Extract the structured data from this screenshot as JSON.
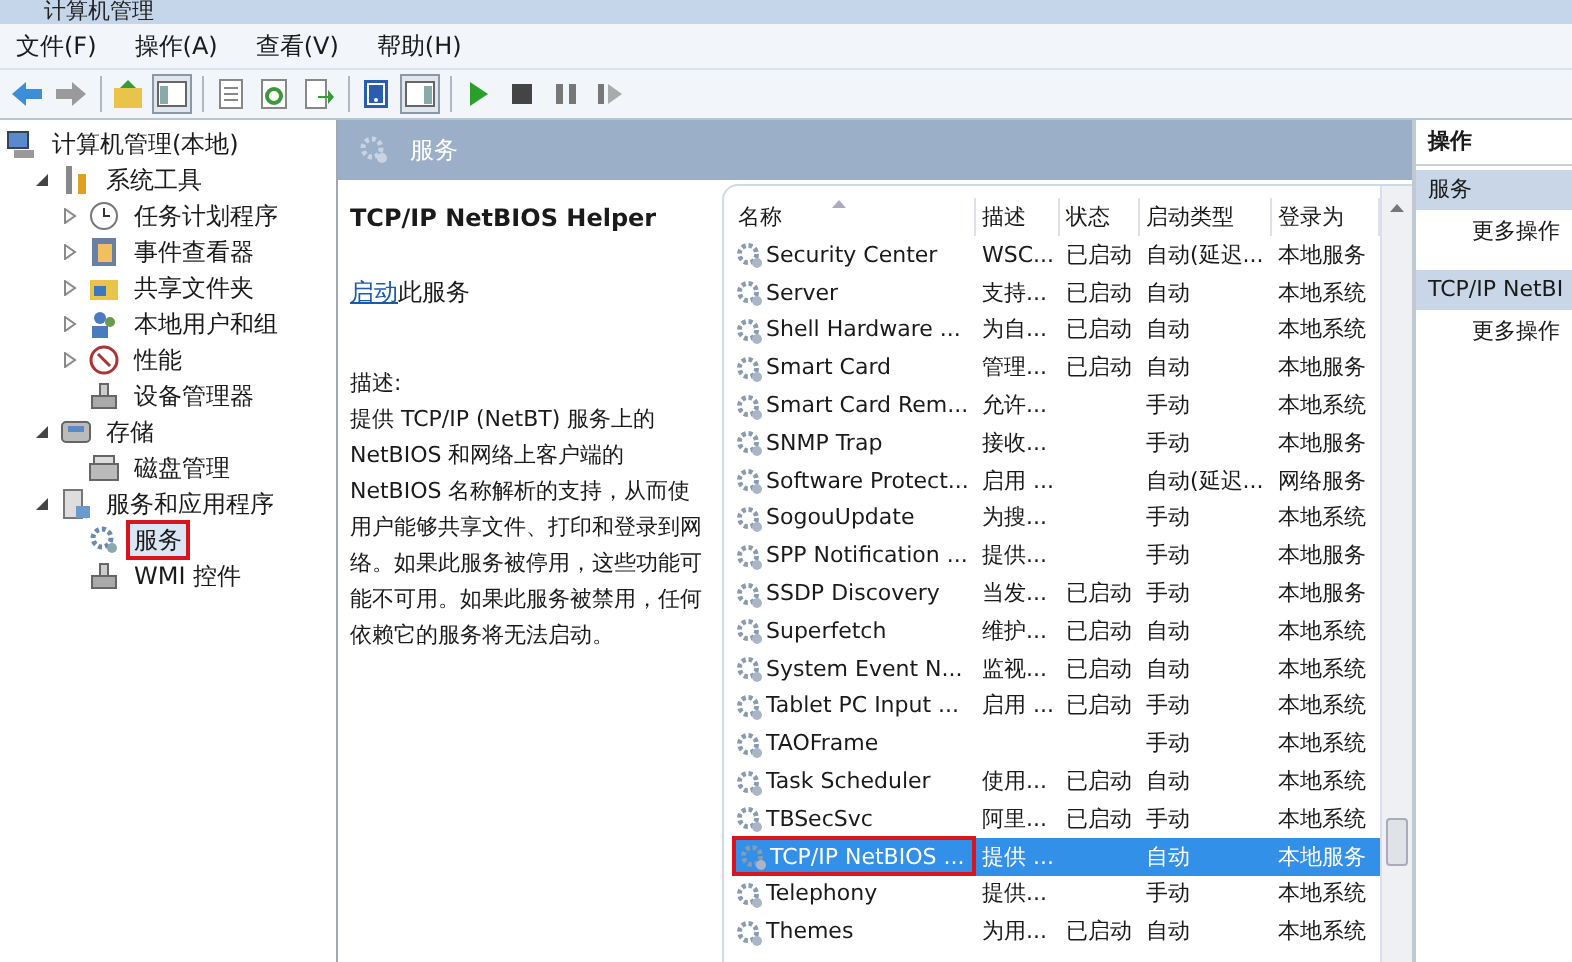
{
  "window": {
    "title": "计算机管理"
  },
  "menu": [
    "文件(F)",
    "操作(A)",
    "查看(V)",
    "帮助(H)"
  ],
  "toolbar": [
    {
      "kind": "back"
    },
    {
      "kind": "forward"
    },
    {
      "kind": "sep"
    },
    {
      "kind": "up"
    },
    {
      "kind": "tree",
      "selected": true
    },
    {
      "kind": "sep"
    },
    {
      "kind": "props"
    },
    {
      "kind": "refresh"
    },
    {
      "kind": "export"
    },
    {
      "kind": "sep"
    },
    {
      "kind": "help"
    },
    {
      "kind": "pane",
      "selected": true
    },
    {
      "kind": "sep"
    },
    {
      "kind": "play"
    },
    {
      "kind": "stop"
    },
    {
      "kind": "pause"
    },
    {
      "kind": "resume"
    }
  ],
  "tree": [
    {
      "label": "计算机管理(本地)",
      "kind": "computer",
      "selected": false,
      "children": [
        {
          "label": "系统工具",
          "kind": "tools",
          "expanded": true,
          "selected": false,
          "children": [
            {
              "label": "任务计划程序",
              "kind": "clock",
              "expanded": false,
              "selected": false
            },
            {
              "label": "事件查看器",
              "kind": "log",
              "expanded": false,
              "selected": false
            },
            {
              "label": "共享文件夹",
              "kind": "folder",
              "expanded": false,
              "selected": false
            },
            {
              "label": "本地用户和组",
              "kind": "users",
              "expanded": false,
              "selected": false
            },
            {
              "label": "性能",
              "kind": "gauge",
              "expanded": false,
              "selected": false
            },
            {
              "label": "设备管理器",
              "kind": "device",
              "selected": false
            }
          ]
        },
        {
          "label": "存储",
          "kind": "storage",
          "expanded": true,
          "selected": false,
          "children": [
            {
              "label": "磁盘管理",
              "kind": "disk",
              "selected": false
            }
          ]
        },
        {
          "label": "服务和应用程序",
          "kind": "apps",
          "expanded": true,
          "selected": false,
          "children": [
            {
              "label": "服务",
              "kind": "gear",
              "selected": true,
              "annotated": true
            },
            {
              "label": "WMI 控件",
              "kind": "device",
              "selected": false
            }
          ]
        }
      ]
    }
  ],
  "header": {
    "title": "服务"
  },
  "details": {
    "service_name": "TCP/IP NetBIOS Helper",
    "action_link": "启动",
    "action_text": "此服务",
    "description_label": "描述:",
    "description": "提供 TCP/IP (NetBT) 服务上的 NetBIOS 和网络上客户端的 NetBIOS 名称解析的支持，从而使用户能够共享文件、打印和登录到网络。如果此服务被停用，这些功能可能不可用。如果此服务被禁用，任何依赖它的服务将无法启动。"
  },
  "table": {
    "columns": [
      "名称",
      "描述",
      "状态",
      "启动类型",
      "登录为"
    ],
    "rows": [
      {
        "cells": [
          "Security Center",
          "WSC...",
          "已启动",
          "自动(延迟...",
          "本地服务"
        ],
        "selected": false
      },
      {
        "cells": [
          "Server",
          "支持...",
          "已启动",
          "自动",
          "本地系统"
        ],
        "selected": false
      },
      {
        "cells": [
          "Shell Hardware ...",
          "为自...",
          "已启动",
          "自动",
          "本地系统"
        ],
        "selected": false
      },
      {
        "cells": [
          "Smart Card",
          "管理...",
          "已启动",
          "自动",
          "本地服务"
        ],
        "selected": false
      },
      {
        "cells": [
          "Smart Card Rem...",
          "允许...",
          "",
          "手动",
          "本地系统"
        ],
        "selected": false
      },
      {
        "cells": [
          "SNMP Trap",
          "接收...",
          "",
          "手动",
          "本地服务"
        ],
        "selected": false
      },
      {
        "cells": [
          "Software Protect...",
          "启用 ...",
          "",
          "自动(延迟...",
          "网络服务"
        ],
        "selected": false
      },
      {
        "cells": [
          "SogouUpdate",
          "为搜...",
          "",
          "手动",
          "本地系统"
        ],
        "selected": false
      },
      {
        "cells": [
          "SPP Notification ...",
          "提供...",
          "",
          "手动",
          "本地服务"
        ],
        "selected": false
      },
      {
        "cells": [
          "SSDP Discovery",
          "当发...",
          "已启动",
          "手动",
          "本地服务"
        ],
        "selected": false
      },
      {
        "cells": [
          "Superfetch",
          "维护...",
          "已启动",
          "自动",
          "本地系统"
        ],
        "selected": false
      },
      {
        "cells": [
          "System Event N...",
          "监视...",
          "已启动",
          "自动",
          "本地系统"
        ],
        "selected": false
      },
      {
        "cells": [
          "Tablet PC Input ...",
          "启用 ...",
          "已启动",
          "手动",
          "本地系统"
        ],
        "selected": false
      },
      {
        "cells": [
          "TAOFrame",
          "",
          "",
          "手动",
          "本地系统"
        ],
        "selected": false
      },
      {
        "cells": [
          "Task Scheduler",
          "使用...",
          "已启动",
          "自动",
          "本地系统"
        ],
        "selected": false
      },
      {
        "cells": [
          "TBSecSvc",
          "阿里...",
          "已启动",
          "手动",
          "本地系统"
        ],
        "selected": false
      },
      {
        "cells": [
          "TCP/IP NetBIOS ...",
          "提供 ...",
          "",
          "自动",
          "本地服务"
        ],
        "selected": true,
        "annotated": true
      },
      {
        "cells": [
          "Telephony",
          "提供...",
          "",
          "手动",
          "本地系统"
        ],
        "selected": false
      },
      {
        "cells": [
          "Themes",
          "为用...",
          "已启动",
          "自动",
          "本地系统"
        ],
        "selected": false
      }
    ]
  },
  "actions": {
    "title": "操作",
    "sections": [
      {
        "title": "服务",
        "items": [
          "更多操作"
        ]
      },
      {
        "title": "TCP/IP NetBI",
        "items": [
          "更多操作"
        ]
      }
    ]
  }
}
